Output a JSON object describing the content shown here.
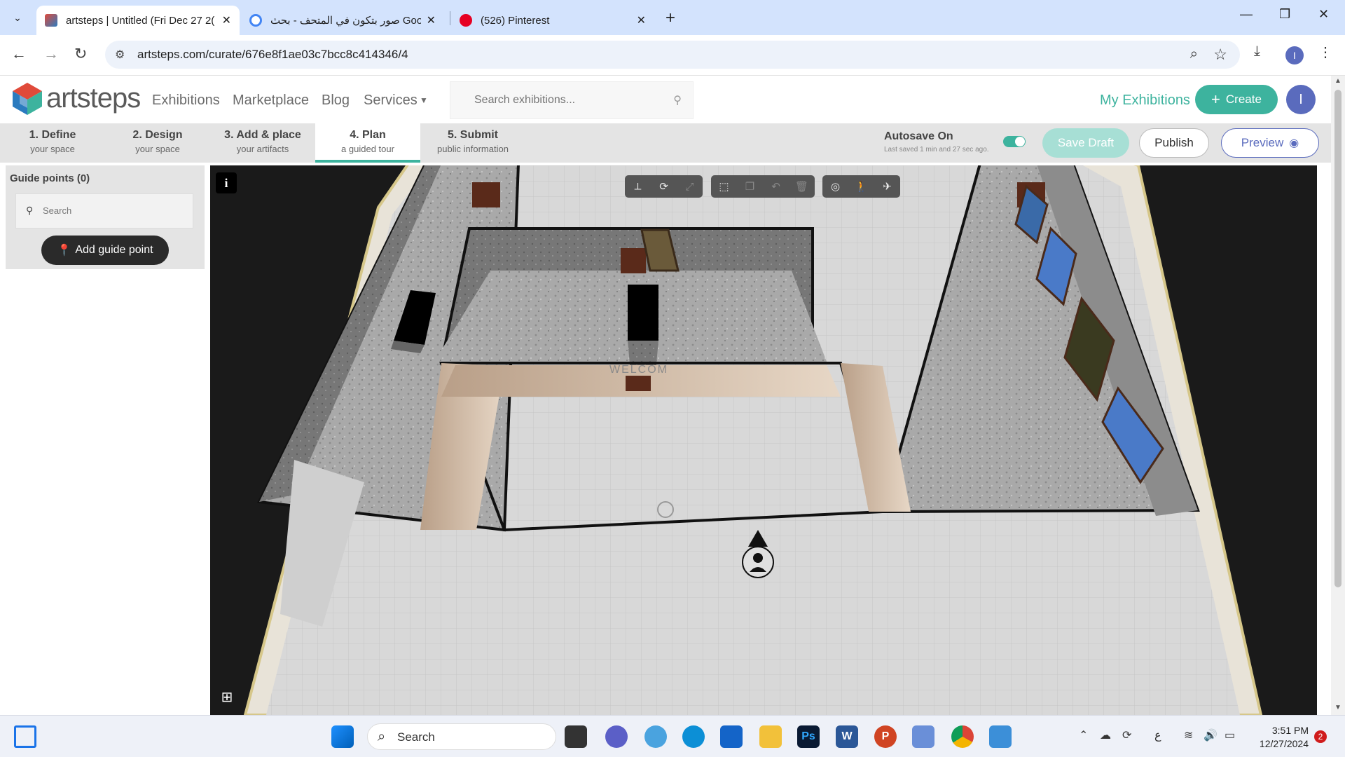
{
  "browser": {
    "tabs": [
      {
        "title": "artsteps | Untitled (Fri Dec 27 2(",
        "active": true
      },
      {
        "title": "صور بتكون في المتحف - بحث Google",
        "active": false
      },
      {
        "title": "(526) Pinterest",
        "active": false
      }
    ],
    "url": "artsteps.com/curate/676e8f1ae03c7bcc8c414346/4",
    "profile_initial": "I"
  },
  "header": {
    "logo_text": "artsteps",
    "nav": [
      "Exhibitions",
      "Marketplace",
      "Blog",
      "Services"
    ],
    "search_placeholder": "Search exhibitions...",
    "my_exhibitions": "My Exhibitions",
    "create": "Create",
    "profile_initial": "I"
  },
  "steps": [
    {
      "title": "1. Define",
      "sub": "your space"
    },
    {
      "title": "2. Design",
      "sub": "your space"
    },
    {
      "title": "3. Add & place",
      "sub": "your artifacts"
    },
    {
      "title": "4. Plan",
      "sub": "a guided tour"
    },
    {
      "title": "5. Submit",
      "sub": "public information"
    }
  ],
  "autosave": {
    "label": "Autosave On",
    "last_saved": "Last saved 1 min and 27 sec ago."
  },
  "actions": {
    "save_draft": "Save Draft",
    "publish": "Publish",
    "preview": "Preview"
  },
  "sidebar": {
    "heading": "Guide points (0)",
    "search_placeholder": "Search",
    "add_button": "Add guide point"
  },
  "scene": {
    "sign": "WELCOM"
  },
  "taskbar": {
    "search_label": "Search",
    "time": "3:51 PM",
    "date": "12/27/2024",
    "notifications": "2",
    "ime": "ع"
  }
}
